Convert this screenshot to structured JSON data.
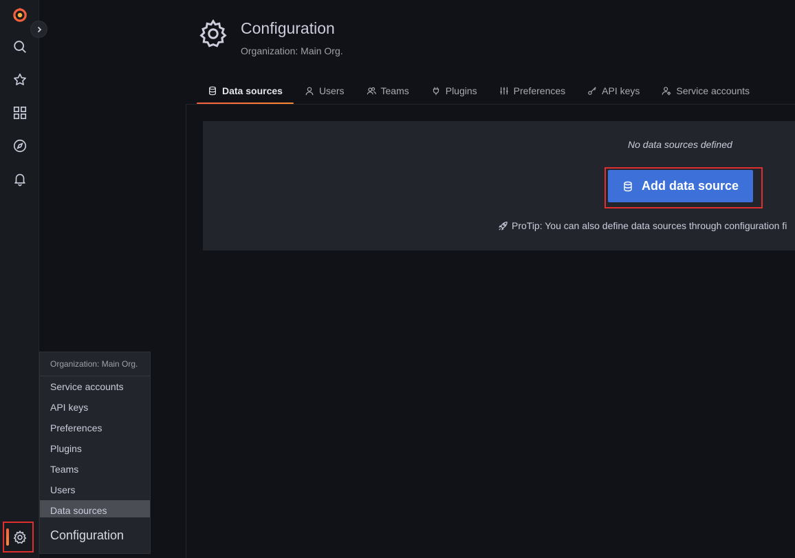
{
  "sidemenu": {
    "items": [
      {
        "icon": "grafana-logo-icon"
      },
      {
        "icon": "search-icon"
      },
      {
        "icon": "star-icon"
      },
      {
        "icon": "dashboards-icon"
      },
      {
        "icon": "explore-compass-icon"
      },
      {
        "icon": "alerting-bell-icon"
      },
      {
        "icon": "gear-icon"
      }
    ]
  },
  "header": {
    "title": "Configuration",
    "subtitle": "Organization: Main Org."
  },
  "tabs": [
    {
      "label": "Data sources",
      "icon": "database-icon",
      "active": true
    },
    {
      "label": "Users",
      "icon": "user-icon",
      "active": false
    },
    {
      "label": "Teams",
      "icon": "users-icon",
      "active": false
    },
    {
      "label": "Plugins",
      "icon": "plug-icon",
      "active": false
    },
    {
      "label": "Preferences",
      "icon": "sliders-icon",
      "active": false
    },
    {
      "label": "API keys",
      "icon": "key-icon",
      "active": false
    },
    {
      "label": "Service accounts",
      "icon": "user-cog-icon",
      "active": false
    }
  ],
  "empty_state": {
    "title": "No data sources defined",
    "button_label": "Add data source",
    "protip": "ProTip: You can also define data sources through configuration fi"
  },
  "flyout": {
    "header": "Organization: Main Org.",
    "items": [
      "Service accounts",
      "API keys",
      "Preferences",
      "Plugins",
      "Teams",
      "Users",
      "Data sources"
    ],
    "active_index": 6,
    "footer": "Configuration"
  },
  "colors": {
    "background": "#111217",
    "sidemenu": "#181b1f",
    "card": "#22252b",
    "primary_button": "#3d71d9",
    "accent": "#f55f3e",
    "highlight_box": "#e02f2f"
  }
}
